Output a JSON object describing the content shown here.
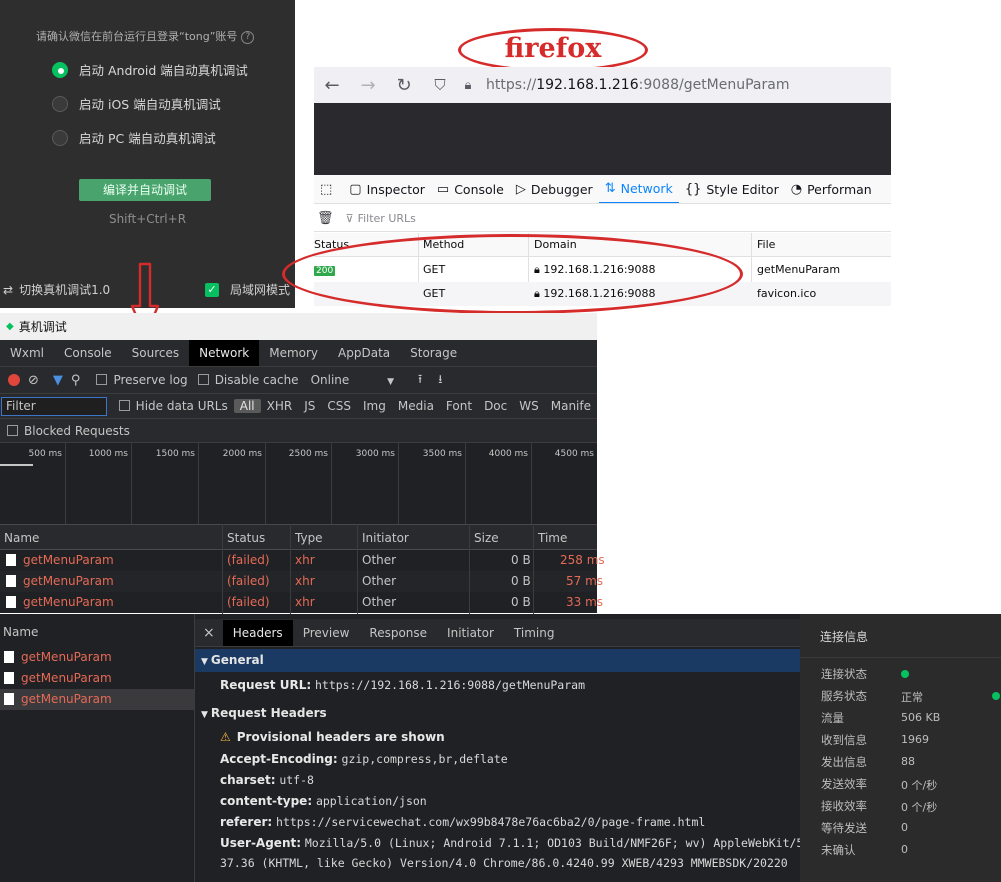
{
  "wechat_panel": {
    "confirm_text": "请确认微信在前台运行且登录“tong”账号",
    "help_icon": "?",
    "options": [
      {
        "label": "启动 Android 端自动真机调试",
        "selected": true
      },
      {
        "label": "启动 iOS 端自动真机调试",
        "selected": false
      },
      {
        "label": "启动 PC 端自动真机调试",
        "selected": false
      }
    ],
    "compile_button": "编译并自动调试",
    "shortcut": "Shift+Ctrl+R",
    "switch_label": "切换真机调试1.0",
    "lan_label": "局域网模式"
  },
  "firefox": {
    "annotation_label": "firefox",
    "url_prefix": "https://",
    "url_host": "192.168.1.216",
    "url_rest": ":9088/getMenuParam",
    "devtools_tabs": [
      "Inspector",
      "Console",
      "Debugger",
      "Network",
      "Style Editor",
      "Performan"
    ],
    "active_tab": "Network",
    "filter_placeholder": "Filter URLs",
    "columns": [
      "Status",
      "Method",
      "Domain",
      "File"
    ],
    "rows": [
      {
        "status": "200",
        "method": "GET",
        "domain": "192.168.1.216:9088",
        "file": "getMenuParam"
      },
      {
        "status": "",
        "method": "GET",
        "domain": "192.168.1.216:9088",
        "file": "favicon.ico"
      }
    ]
  },
  "chrome_devtools": {
    "window_title": "真机调试",
    "tabs": [
      "Wxml",
      "Console",
      "Sources",
      "Network",
      "Memory",
      "AppData",
      "Storage"
    ],
    "active_tab": "Network",
    "preserve_log": "Preserve log",
    "disable_cache": "Disable cache",
    "throttle": "Online",
    "filter_placeholder": "Filter",
    "hide_data_urls": "Hide data URLs",
    "types": [
      "All",
      "XHR",
      "JS",
      "CSS",
      "Img",
      "Media",
      "Font",
      "Doc",
      "WS",
      "Manife"
    ],
    "blocked_requests": "Blocked Requests",
    "timeline_ticks": [
      "500 ms",
      "1000 ms",
      "1500 ms",
      "2000 ms",
      "2500 ms",
      "3000 ms",
      "3500 ms",
      "4000 ms",
      "4500 ms"
    ],
    "columns": [
      "Name",
      "Status",
      "Type",
      "Initiator",
      "Size",
      "Time"
    ],
    "requests": [
      {
        "name": "getMenuParam",
        "status": "(failed)",
        "type": "xhr",
        "initiator": "Other",
        "size": "0 B",
        "time": "258 ms"
      },
      {
        "name": "getMenuParam",
        "status": "(failed)",
        "type": "xhr",
        "initiator": "Other",
        "size": "0 B",
        "time": "57 ms"
      },
      {
        "name": "getMenuParam",
        "status": "(failed)",
        "type": "xhr",
        "initiator": "Other",
        "size": "0 B",
        "time": "33 ms"
      }
    ],
    "lower": {
      "name_header": "Name",
      "names": [
        "getMenuParam",
        "getMenuParam",
        "getMenuParam"
      ],
      "close": "×",
      "detail_tabs": [
        "Headers",
        "Preview",
        "Response",
        "Initiator",
        "Timing"
      ],
      "active_detail_tab": "Headers",
      "general_title": "General",
      "request_url_key": "Request URL:",
      "request_url_val": "https://192.168.1.216:9088/getMenuParam",
      "request_headers_title": "Request Headers",
      "provisional_warning": "Provisional headers are shown",
      "headers": [
        {
          "key": "Accept-Encoding:",
          "value": "gzip,compress,br,deflate"
        },
        {
          "key": "charset:",
          "value": "utf-8"
        },
        {
          "key": "content-type:",
          "value": "application/json"
        },
        {
          "key": "referer:",
          "value": "https://servicewechat.com/wx99b8478e76ac6ba2/0/page-frame.html"
        },
        {
          "key": "User-Agent:",
          "value": "Mozilla/5.0 (Linux; Android 7.1.1; OD103 Build/NMF26F; wv) AppleWebKit/5"
        }
      ],
      "ua_continuation": "37.36 (KHTML, like Gecko) Version/4.0 Chrome/86.0.4240.99 XWEB/4293 MMWEBSDK/20220"
    }
  },
  "connection_panel": {
    "title": "连接信息",
    "items": [
      {
        "label": "连接状态",
        "value": ""
      },
      {
        "label": "服务状态",
        "value": "正常"
      },
      {
        "label": "流量",
        "value": "506 KB"
      },
      {
        "label": "收到信息",
        "value": "1969"
      },
      {
        "label": "发出信息",
        "value": "88"
      },
      {
        "label": "发送效率",
        "value": "0 个/秒"
      },
      {
        "label": "接收效率",
        "value": "0 个/秒"
      },
      {
        "label": "等待发送",
        "value": "0"
      },
      {
        "label": "未确认",
        "value": "0"
      }
    ]
  }
}
